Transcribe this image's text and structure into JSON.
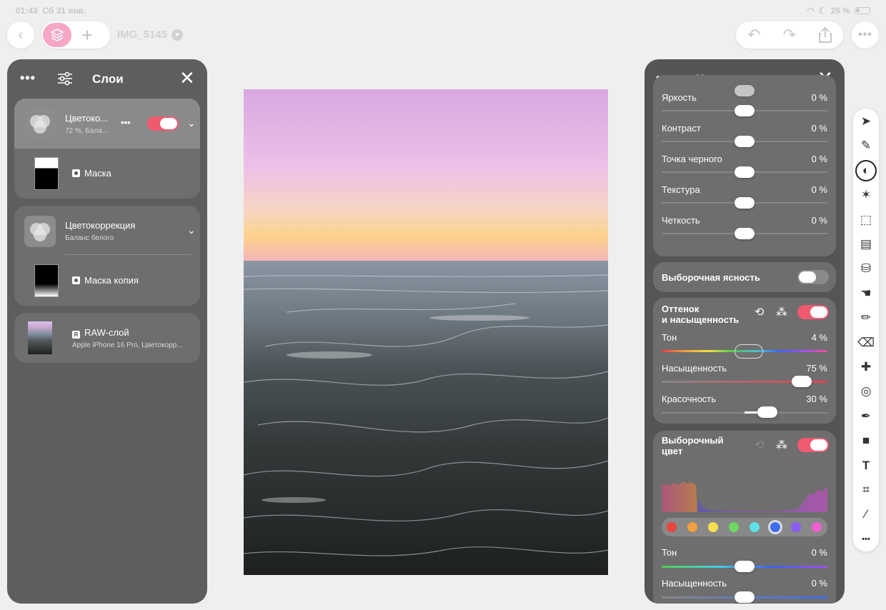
{
  "status": {
    "time": "01:43",
    "date": "Сб 31 янв.",
    "battery": "26 %"
  },
  "topbar": {
    "doc_title": "IMG_5145"
  },
  "layers_panel": {
    "title": "Слои",
    "layers": [
      {
        "name": "Цветоко...",
        "subtitle": "72 %, Бала...",
        "mask_label": "Маска",
        "enabled": true
      },
      {
        "name": "Цветокоррекция",
        "subtitle": "Баланс белого",
        "mask_label": "Маска копия"
      },
      {
        "name": "RAW-слой",
        "subtitle": "Apple iPhone 16 Pro, Цветокорр..."
      }
    ]
  },
  "adjust_panel": {
    "title": "Цветокоррекция",
    "basic": [
      {
        "label": "Яркость",
        "value": "0 %"
      },
      {
        "label": "Контраст",
        "value": "0 %"
      },
      {
        "label": "Точка черного",
        "value": "0 %"
      },
      {
        "label": "Текстура",
        "value": "0 %"
      },
      {
        "label": "Четкость",
        "value": "0 %"
      }
    ],
    "selective_clarity": {
      "label": "Выборочная ясность",
      "enabled": false
    },
    "hue_sat": {
      "title_line1": "Оттенок",
      "title_line2": "и насыщенность",
      "enabled": true,
      "rows": [
        {
          "label": "Тон",
          "value": "4 %"
        },
        {
          "label": "Насыщенность",
          "value": "75 %"
        },
        {
          "label": "Красочность",
          "value": "30 %"
        }
      ]
    },
    "selective_color": {
      "title_line1": "Выборочный",
      "title_line2": "цвет",
      "enabled": true,
      "swatches": [
        "#e8453c",
        "#f0a040",
        "#f5e050",
        "#6ed860",
        "#5ee0e8",
        "#3c6ef0",
        "#8a5ef0",
        "#f060d0"
      ],
      "selected_swatch": 5,
      "rows": [
        {
          "label": "Тон",
          "value": "0 %"
        },
        {
          "label": "Насыщенность",
          "value": "0 %"
        }
      ]
    }
  },
  "toolbar": {
    "tools": [
      "pointer-icon",
      "brush-adjust-icon",
      "adjustments-icon",
      "effects-icon",
      "selection-icon",
      "gradient-icon",
      "fill-icon",
      "smudge-icon",
      "paint-icon",
      "eraser-icon",
      "heal-icon",
      "clone-icon",
      "pen-icon",
      "shape-icon",
      "text-icon",
      "crop-icon",
      "eyedropper-icon",
      "more-icon"
    ],
    "active": 2
  }
}
